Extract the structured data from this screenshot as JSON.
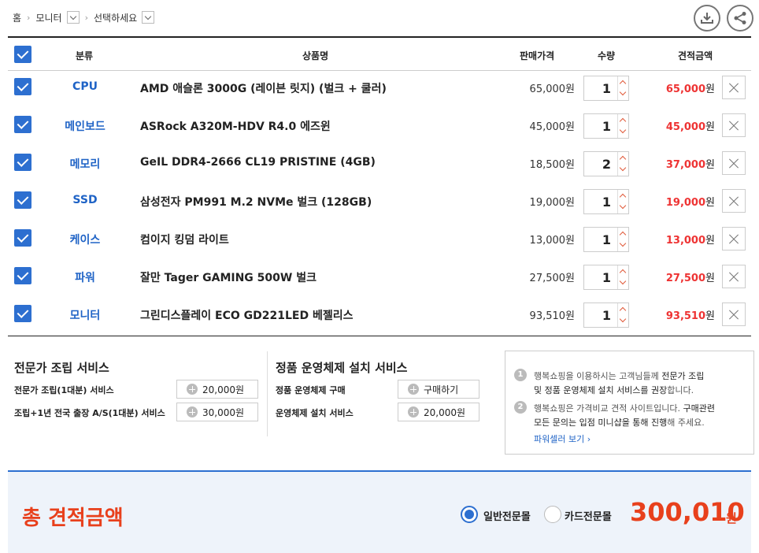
{
  "breadcrumb": {
    "home": "홈",
    "level1": "모니터",
    "level2": "선택하세요"
  },
  "toolbar": {
    "download_icon": "download-icon",
    "share_icon": "share-icon"
  },
  "table": {
    "headers": {
      "category": "분류",
      "product": "상품명",
      "price": "판매가격",
      "qty": "수량",
      "total": "견적금액"
    },
    "currency": "원",
    "rows": [
      {
        "category": "CPU",
        "name": "AMD 애슬론 3000G (레이븐 릿지) (벌크 + 쿨러)",
        "price": "65,000원",
        "qty": "1",
        "total": "65,000"
      },
      {
        "category": "메인보드",
        "name": "ASRock A320M-HDV R4.0 에즈윈",
        "price": "45,000원",
        "qty": "1",
        "total": "45,000"
      },
      {
        "category": "메모리",
        "name": "GeIL DDR4-2666 CL19 PRISTINE (4GB)",
        "price": "18,500원",
        "qty": "2",
        "total": "37,000"
      },
      {
        "category": "SSD",
        "name": "삼성전자 PM991 M.2 NVMe 벌크 (128GB)",
        "price": "19,000원",
        "qty": "1",
        "total": "19,000"
      },
      {
        "category": "케이스",
        "name": "컴이지 킹덤 라이트",
        "price": "13,000원",
        "qty": "1",
        "total": "13,000"
      },
      {
        "category": "파워",
        "name": "잘만 Tager GAMING 500W 벌크",
        "price": "27,500원",
        "qty": "1",
        "total": "27,500"
      },
      {
        "category": "모니터",
        "name": "그린디스플레이 ECO GD221LED 베젤리스",
        "price": "93,510원",
        "qty": "1",
        "total": "93,510"
      }
    ]
  },
  "assembly": {
    "title": "전문가 조립 서비스",
    "items": [
      {
        "label": "전문가 조립(1대분) 서비스",
        "button": "20,000원"
      },
      {
        "label": "조립+1년 전국 출장 A/S(1대분) 서비스",
        "button": "30,000원"
      }
    ]
  },
  "os": {
    "title": "정품 운영체제 설치 서비스",
    "items": [
      {
        "label": "정품 운영체제 구매",
        "button": "구매하기"
      },
      {
        "label": "운영체제 설치 서비스",
        "button": "20,000원"
      }
    ]
  },
  "notice": {
    "n1": "1",
    "n2": "2",
    "line1a": "행복쇼핑을 이용하시는 고객님들께 ",
    "line1b": "전문가 조립",
    "line2a": "및 정품 운영체제 설치 서비스를 ",
    "line2b": "권장",
    "line2c": "합니다.",
    "line3a": "행복쇼핑은 가격비교 견적 사이트입니다. ",
    "line3b": "구매관련",
    "line4a": "모든 문의는 ",
    "line4b": "입점 미니샵을 통해 진행",
    "line4c": "해 주세요.",
    "link": "파워셀러 보기 ›"
  },
  "summary": {
    "label": "총 견적금액",
    "option1": "일반전문몰",
    "option2": "카드전문몰",
    "selected": "일반전문몰",
    "amount": "300,010",
    "unit": "원"
  },
  "colors": {
    "accent": "#2d6fd0",
    "price_red": "#e33333",
    "total_red": "#e8401c"
  }
}
